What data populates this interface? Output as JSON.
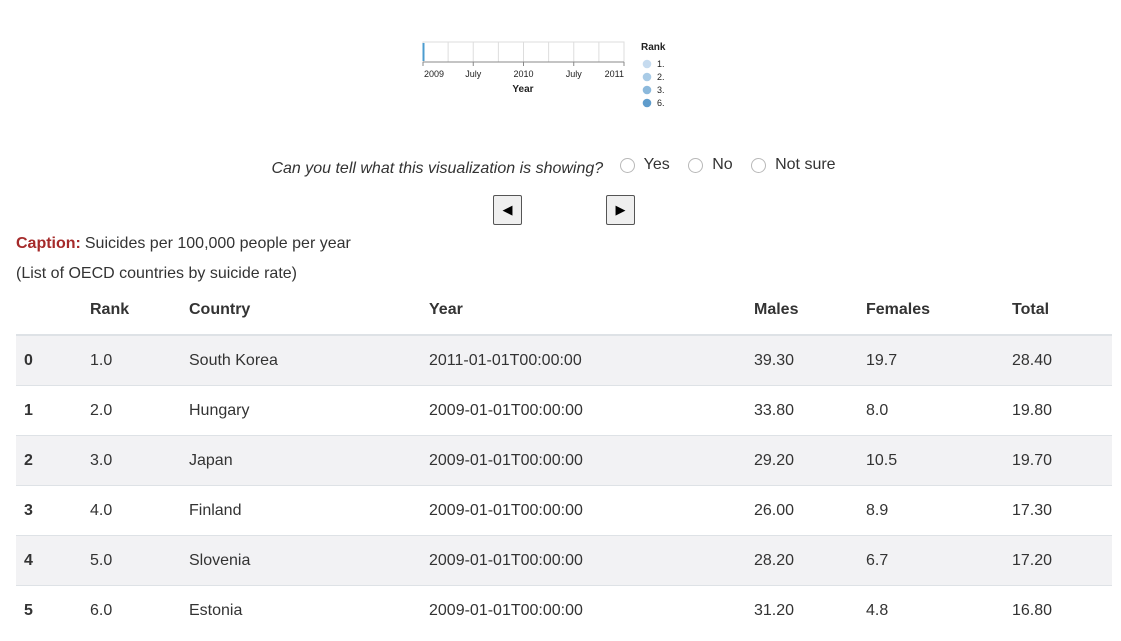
{
  "chart_data": {
    "type": "scatter",
    "x_axis": {
      "title": "Year",
      "ticks": [
        "2009",
        "July",
        "2010",
        "July",
        "2011"
      ]
    },
    "legend": {
      "title": "Rank",
      "placement": "right",
      "entries": [
        "1.",
        "2.",
        "3.",
        "6."
      ]
    },
    "grid": true
  },
  "question": {
    "text": "Can you tell what this visualization is showing?",
    "options": [
      "Yes",
      "No",
      "Not sure"
    ]
  },
  "nav": {
    "prev": "◀",
    "next": "▶"
  },
  "caption": {
    "label": "Caption:",
    "text": "Suicides per 100,000 people per year",
    "source": "(List of OECD countries by suicide rate)"
  },
  "table": {
    "columns": [
      "",
      "Rank",
      "Country",
      "Year",
      "Males",
      "Females",
      "Total"
    ],
    "rows": [
      [
        "0",
        "1.0",
        "South Korea",
        "2011-01-01T00:00:00",
        "39.30",
        "19.7",
        "28.40"
      ],
      [
        "1",
        "2.0",
        "Hungary",
        "2009-01-01T00:00:00",
        "33.80",
        "8.0",
        "19.80"
      ],
      [
        "2",
        "3.0",
        "Japan",
        "2009-01-01T00:00:00",
        "29.20",
        "10.5",
        "19.70"
      ],
      [
        "3",
        "4.0",
        "Finland",
        "2009-01-01T00:00:00",
        "26.00",
        "8.9",
        "17.30"
      ],
      [
        "4",
        "5.0",
        "Slovenia",
        "2009-01-01T00:00:00",
        "28.20",
        "6.7",
        "17.20"
      ],
      [
        "5",
        "6.0",
        "Estonia",
        "2009-01-01T00:00:00",
        "31.20",
        "4.8",
        "16.80"
      ]
    ]
  }
}
